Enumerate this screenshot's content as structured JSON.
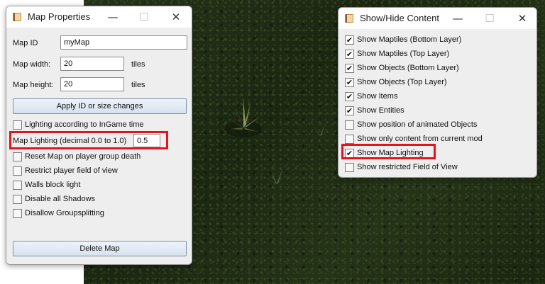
{
  "map_properties": {
    "title": "Map Properties",
    "map_id_label": "Map ID",
    "map_id_value": "myMap",
    "width_label": "Map width:",
    "width_value": "20",
    "width_unit": "tiles",
    "height_label": "Map height:",
    "height_value": "20",
    "height_unit": "tiles",
    "apply_button": "Apply ID or size changes",
    "lighting_ingame_label": "Lighting according to InGame time",
    "lighting_ingame_checked": false,
    "lighting_label": "Map Lighting (decimal 0.0 to 1.0)",
    "lighting_value": "0.5",
    "options": [
      {
        "label": "Reset Map on player group death",
        "checked": false
      },
      {
        "label": "Restrict player field of view",
        "checked": false
      },
      {
        "label": "Walls block light",
        "checked": false
      },
      {
        "label": "Disable all Shadows",
        "checked": false
      },
      {
        "label": "Disallow Groupsplitting",
        "checked": false
      }
    ],
    "delete_button": "Delete Map"
  },
  "show_hide": {
    "title": "Show/Hide Content",
    "items": [
      {
        "label": "Show Maptiles (Bottom Layer)",
        "checked": true
      },
      {
        "label": "Show Maptiles (Top Layer)",
        "checked": true
      },
      {
        "label": "Show Objects (Bottom Layer)",
        "checked": true
      },
      {
        "label": "Show Objects (Top Layer)",
        "checked": true
      },
      {
        "label": "Show Items",
        "checked": true
      },
      {
        "label": "Show Entities",
        "checked": true
      },
      {
        "label": "Show position of animated Objects",
        "checked": false
      },
      {
        "label": "Show only content from current mod",
        "checked": false
      },
      {
        "label": "Show Map Lighting",
        "checked": true
      },
      {
        "label": "Show restricted Field of View",
        "checked": false
      }
    ]
  },
  "window_controls": {
    "minimize": "—",
    "maximize": "☐",
    "close": "✕"
  },
  "colors": {
    "highlight": "#e3141b",
    "map_ground": "#1f2b13",
    "button_border": "#7b8ea6"
  },
  "icons": {
    "app": "book-icon",
    "check": "check-icon"
  }
}
